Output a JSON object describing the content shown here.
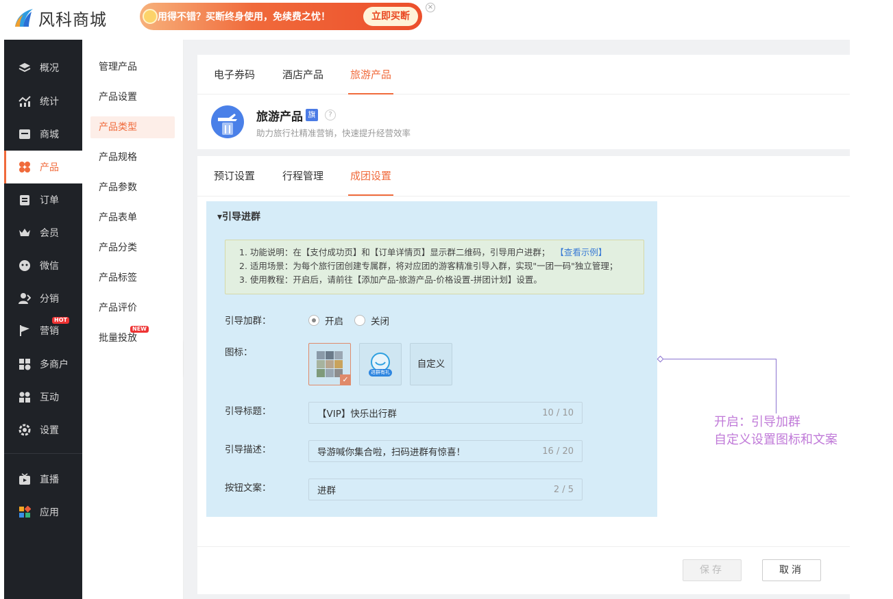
{
  "brand": {
    "logo_text": "风科商城"
  },
  "banner": {
    "text": "用得不错？买断终身使用，免续费之忧！",
    "button": "立即买断",
    "close": "×"
  },
  "sidebar": {
    "items": [
      {
        "label": "概况",
        "icon": "layers-icon"
      },
      {
        "label": "统计",
        "icon": "chart-icon"
      },
      {
        "label": "商城",
        "icon": "store-icon"
      },
      {
        "label": "产品",
        "icon": "clover-icon"
      },
      {
        "label": "订单",
        "icon": "clipboard-icon"
      },
      {
        "label": "会员",
        "icon": "crown-icon"
      },
      {
        "label": "微信",
        "icon": "chat-icon"
      },
      {
        "label": "分销",
        "icon": "users-icon"
      },
      {
        "label": "营销",
        "icon": "flag-icon",
        "badge": "HOT"
      },
      {
        "label": "多商户",
        "icon": "shop-plus-icon"
      },
      {
        "label": "互动",
        "icon": "grid-icon"
      },
      {
        "label": "设置",
        "icon": "gear-icon"
      },
      {
        "label": "直播",
        "icon": "tv-icon"
      },
      {
        "label": "应用",
        "icon": "apps-icon"
      }
    ],
    "active_color": "#f06a3b"
  },
  "subnav": {
    "items": [
      "管理产品",
      "产品设置",
      "产品类型",
      "产品规格",
      "产品参数",
      "产品表单",
      "产品分类",
      "产品标签",
      "产品评价",
      "批量投放"
    ],
    "active_index": 2,
    "new_badge": "NEW"
  },
  "product_tabs": [
    "电子券码",
    "酒店产品",
    "旅游产品"
  ],
  "product": {
    "title": "旅游产品",
    "flag": "旗",
    "help": "?",
    "subtitle": "助力旅行社精准营销，快速提升经营效率"
  },
  "setting_tabs": [
    "预订设置",
    "行程管理",
    "成团设置"
  ],
  "section": {
    "title": "▾引导进群",
    "notice": {
      "line1": "1. 功能说明：在【支付成功页】和【订单详情页】显示群二维码，引导用户进群；",
      "line1_link": "【查看示例】",
      "line2": "2. 适用场景：为每个旅行团创建专属群，将对应团的游客精准引导入群，实现\"一团一码\"独立管理；",
      "line3": "3. 使用教程：开启后，请前往【添加产品-旅游产品-价格设置-拼团计划】设置。"
    },
    "join_group": {
      "label": "引导加群：",
      "on": "开启",
      "off": "关闭",
      "value": "开启"
    },
    "icon_field": {
      "label": "图标：",
      "icon2_caption": "进群有礼",
      "custom": "自定义"
    },
    "title_field": {
      "label": "引导标题：",
      "value": "【VIP】快乐出行群",
      "count": "10 / 10"
    },
    "desc_field": {
      "label": "引导描述：",
      "value": "导游喊你集合啦，扫码进群有惊喜！",
      "count": "16 / 20"
    },
    "button_field": {
      "label": "按钮文案：",
      "value": "进群",
      "count": "2 / 5"
    }
  },
  "callout": {
    "line1": "开启：引导加群",
    "line2": "自定义设置图标和文案"
  },
  "footer": {
    "save": "保存",
    "cancel": "取消"
  }
}
